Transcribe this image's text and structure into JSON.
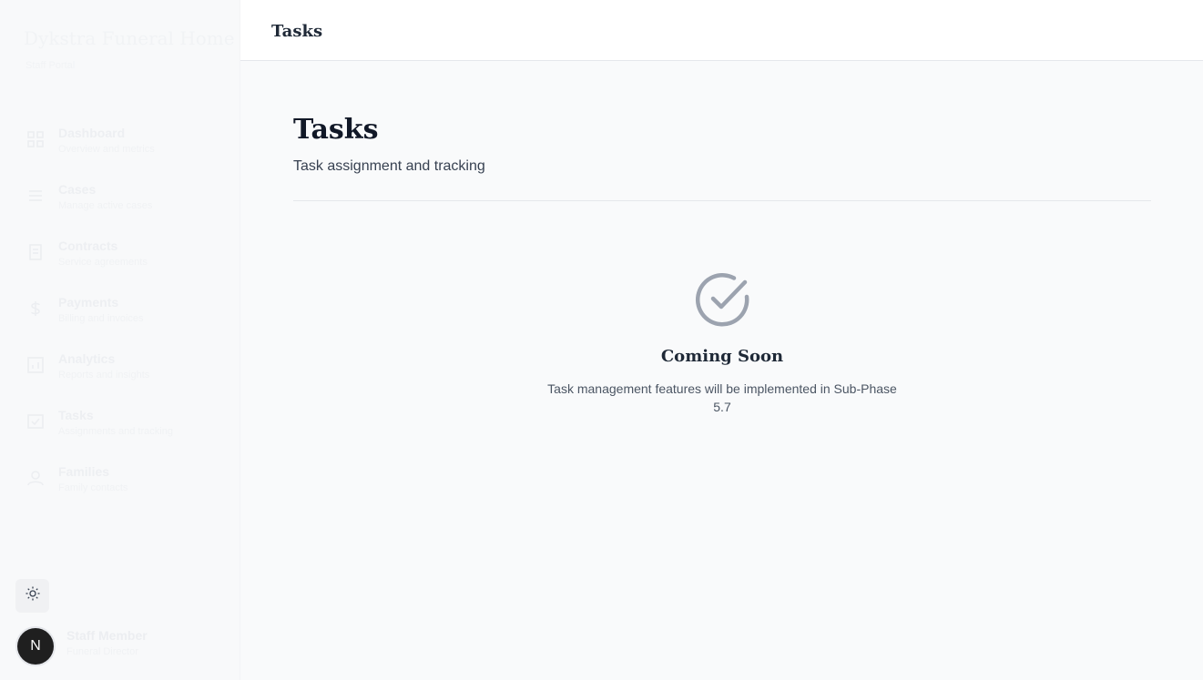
{
  "sidebar": {
    "brand_title": "Dykstra Funeral Home",
    "brand_subtitle": "Staff Portal",
    "items": [
      {
        "label": "Dashboard",
        "desc": "Overview and metrics",
        "icon": "grid-icon"
      },
      {
        "label": "Cases",
        "desc": "Manage active cases",
        "icon": "list-icon"
      },
      {
        "label": "Contracts",
        "desc": "Service agreements",
        "icon": "document-icon"
      },
      {
        "label": "Payments",
        "desc": "Billing and invoices",
        "icon": "dollar-icon"
      },
      {
        "label": "Analytics",
        "desc": "Reports and insights",
        "icon": "chart-icon"
      },
      {
        "label": "Tasks",
        "desc": "Assignments and tracking",
        "icon": "task-icon"
      },
      {
        "label": "Families",
        "desc": "Family contacts",
        "icon": "users-icon"
      }
    ],
    "user": {
      "initial": "N",
      "name": "Staff Member",
      "role": "Funeral Director"
    }
  },
  "topbar": {
    "title": "Tasks"
  },
  "main": {
    "title": "Tasks",
    "subtitle": "Task assignment and tracking",
    "empty_state": {
      "icon": "check-circle-icon",
      "title": "Coming Soon",
      "description": "Task management features will be implemented in Sub-Phase 5.7"
    }
  },
  "colors": {
    "background": "#f9fafb",
    "sidebar": "#f8f9fa",
    "text_primary": "#111827",
    "text_secondary": "#4b5563",
    "icon_gray": "#9ca3af",
    "avatar": "#1f1f1f"
  }
}
